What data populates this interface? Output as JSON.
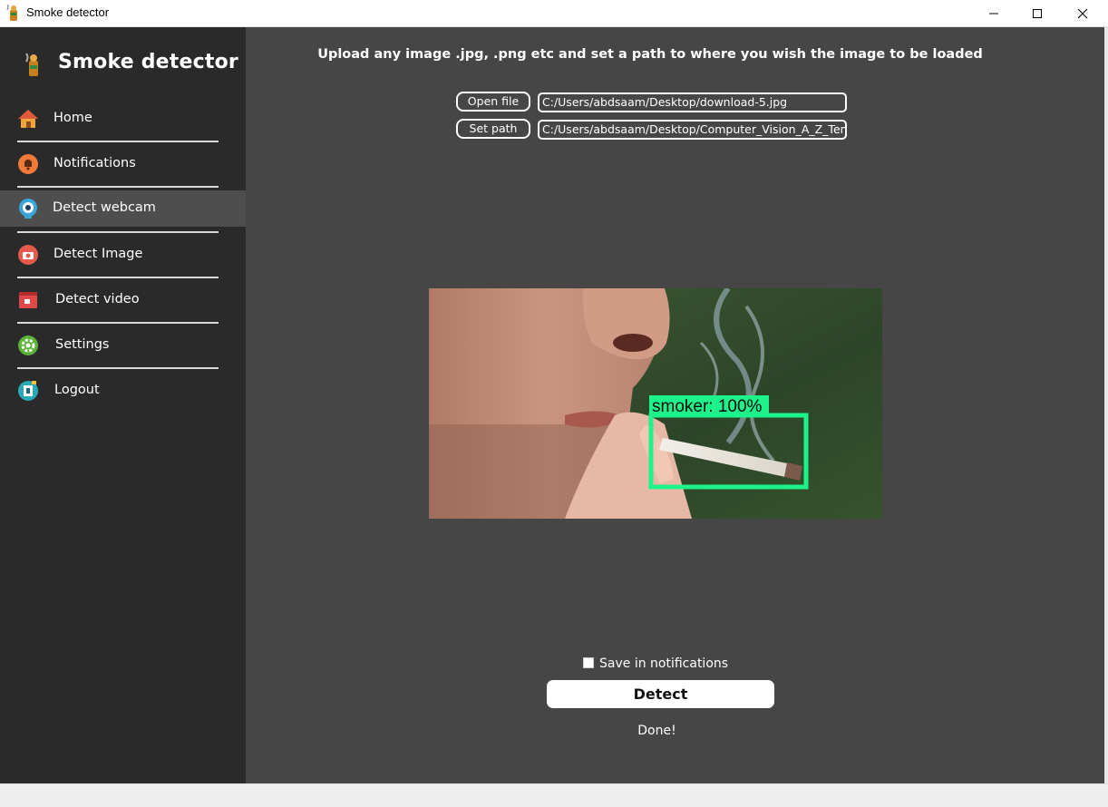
{
  "window": {
    "title": "Smoke detector",
    "controls": [
      "minimize-icon",
      "maximize-icon",
      "close-icon"
    ]
  },
  "sidebar": {
    "brand": "Smoke detector",
    "items": [
      {
        "label": "Home",
        "icon": "house-icon",
        "active": false
      },
      {
        "label": "Notifications",
        "icon": "bell-icon",
        "active": false
      },
      {
        "label": "Detect webcam",
        "icon": "webcam-icon",
        "active": true
      },
      {
        "label": "Detect Image",
        "icon": "camera-icon",
        "active": false
      },
      {
        "label": "Detect video",
        "icon": "video-icon",
        "active": false
      },
      {
        "label": "Settings",
        "icon": "gear-icon",
        "active": false
      },
      {
        "label": "Logout",
        "icon": "logout-icon",
        "active": false
      }
    ]
  },
  "main": {
    "instruction": "Upload any image .jpg, .png etc and set a path to where you wish the image to be loaded",
    "open_file_label": "Open file",
    "open_file_value": "C:/Users/abdsaam/Desktop/download-5.jpg",
    "set_path_label": "Set path",
    "set_path_value": "C:/Users/abdsaam/Desktop/Computer_Vision_A_Z_Temp",
    "detection_label": "smoker: 100%",
    "save_label": "Save in notifications",
    "save_checked": false,
    "detect_label": "Detect",
    "status": "Done!"
  },
  "colors": {
    "sidebar_bg": "#2a2a2a",
    "sidebar_active": "#4e4e4e",
    "main_bg": "#464646",
    "detection_box": "#1ef28a"
  }
}
